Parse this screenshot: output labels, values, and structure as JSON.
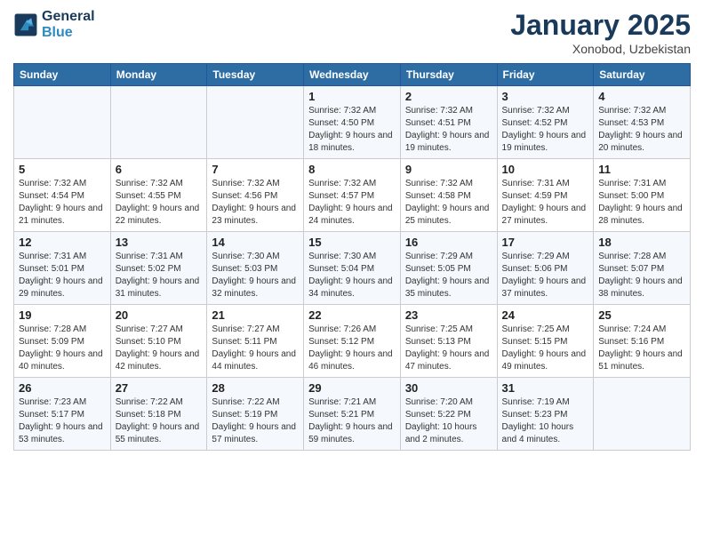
{
  "header": {
    "logo_line1": "General",
    "logo_line2": "Blue",
    "month": "January 2025",
    "location": "Xonobod, Uzbekistan"
  },
  "weekdays": [
    "Sunday",
    "Monday",
    "Tuesday",
    "Wednesday",
    "Thursday",
    "Friday",
    "Saturday"
  ],
  "weeks": [
    [
      {
        "num": "",
        "sunrise": "",
        "sunset": "",
        "daylight": ""
      },
      {
        "num": "",
        "sunrise": "",
        "sunset": "",
        "daylight": ""
      },
      {
        "num": "",
        "sunrise": "",
        "sunset": "",
        "daylight": ""
      },
      {
        "num": "1",
        "sunrise": "Sunrise: 7:32 AM",
        "sunset": "Sunset: 4:50 PM",
        "daylight": "Daylight: 9 hours and 18 minutes."
      },
      {
        "num": "2",
        "sunrise": "Sunrise: 7:32 AM",
        "sunset": "Sunset: 4:51 PM",
        "daylight": "Daylight: 9 hours and 19 minutes."
      },
      {
        "num": "3",
        "sunrise": "Sunrise: 7:32 AM",
        "sunset": "Sunset: 4:52 PM",
        "daylight": "Daylight: 9 hours and 19 minutes."
      },
      {
        "num": "4",
        "sunrise": "Sunrise: 7:32 AM",
        "sunset": "Sunset: 4:53 PM",
        "daylight": "Daylight: 9 hours and 20 minutes."
      }
    ],
    [
      {
        "num": "5",
        "sunrise": "Sunrise: 7:32 AM",
        "sunset": "Sunset: 4:54 PM",
        "daylight": "Daylight: 9 hours and 21 minutes."
      },
      {
        "num": "6",
        "sunrise": "Sunrise: 7:32 AM",
        "sunset": "Sunset: 4:55 PM",
        "daylight": "Daylight: 9 hours and 22 minutes."
      },
      {
        "num": "7",
        "sunrise": "Sunrise: 7:32 AM",
        "sunset": "Sunset: 4:56 PM",
        "daylight": "Daylight: 9 hours and 23 minutes."
      },
      {
        "num": "8",
        "sunrise": "Sunrise: 7:32 AM",
        "sunset": "Sunset: 4:57 PM",
        "daylight": "Daylight: 9 hours and 24 minutes."
      },
      {
        "num": "9",
        "sunrise": "Sunrise: 7:32 AM",
        "sunset": "Sunset: 4:58 PM",
        "daylight": "Daylight: 9 hours and 25 minutes."
      },
      {
        "num": "10",
        "sunrise": "Sunrise: 7:31 AM",
        "sunset": "Sunset: 4:59 PM",
        "daylight": "Daylight: 9 hours and 27 minutes."
      },
      {
        "num": "11",
        "sunrise": "Sunrise: 7:31 AM",
        "sunset": "Sunset: 5:00 PM",
        "daylight": "Daylight: 9 hours and 28 minutes."
      }
    ],
    [
      {
        "num": "12",
        "sunrise": "Sunrise: 7:31 AM",
        "sunset": "Sunset: 5:01 PM",
        "daylight": "Daylight: 9 hours and 29 minutes."
      },
      {
        "num": "13",
        "sunrise": "Sunrise: 7:31 AM",
        "sunset": "Sunset: 5:02 PM",
        "daylight": "Daylight: 9 hours and 31 minutes."
      },
      {
        "num": "14",
        "sunrise": "Sunrise: 7:30 AM",
        "sunset": "Sunset: 5:03 PM",
        "daylight": "Daylight: 9 hours and 32 minutes."
      },
      {
        "num": "15",
        "sunrise": "Sunrise: 7:30 AM",
        "sunset": "Sunset: 5:04 PM",
        "daylight": "Daylight: 9 hours and 34 minutes."
      },
      {
        "num": "16",
        "sunrise": "Sunrise: 7:29 AM",
        "sunset": "Sunset: 5:05 PM",
        "daylight": "Daylight: 9 hours and 35 minutes."
      },
      {
        "num": "17",
        "sunrise": "Sunrise: 7:29 AM",
        "sunset": "Sunset: 5:06 PM",
        "daylight": "Daylight: 9 hours and 37 minutes."
      },
      {
        "num": "18",
        "sunrise": "Sunrise: 7:28 AM",
        "sunset": "Sunset: 5:07 PM",
        "daylight": "Daylight: 9 hours and 38 minutes."
      }
    ],
    [
      {
        "num": "19",
        "sunrise": "Sunrise: 7:28 AM",
        "sunset": "Sunset: 5:09 PM",
        "daylight": "Daylight: 9 hours and 40 minutes."
      },
      {
        "num": "20",
        "sunrise": "Sunrise: 7:27 AM",
        "sunset": "Sunset: 5:10 PM",
        "daylight": "Daylight: 9 hours and 42 minutes."
      },
      {
        "num": "21",
        "sunrise": "Sunrise: 7:27 AM",
        "sunset": "Sunset: 5:11 PM",
        "daylight": "Daylight: 9 hours and 44 minutes."
      },
      {
        "num": "22",
        "sunrise": "Sunrise: 7:26 AM",
        "sunset": "Sunset: 5:12 PM",
        "daylight": "Daylight: 9 hours and 46 minutes."
      },
      {
        "num": "23",
        "sunrise": "Sunrise: 7:25 AM",
        "sunset": "Sunset: 5:13 PM",
        "daylight": "Daylight: 9 hours and 47 minutes."
      },
      {
        "num": "24",
        "sunrise": "Sunrise: 7:25 AM",
        "sunset": "Sunset: 5:15 PM",
        "daylight": "Daylight: 9 hours and 49 minutes."
      },
      {
        "num": "25",
        "sunrise": "Sunrise: 7:24 AM",
        "sunset": "Sunset: 5:16 PM",
        "daylight": "Daylight: 9 hours and 51 minutes."
      }
    ],
    [
      {
        "num": "26",
        "sunrise": "Sunrise: 7:23 AM",
        "sunset": "Sunset: 5:17 PM",
        "daylight": "Daylight: 9 hours and 53 minutes."
      },
      {
        "num": "27",
        "sunrise": "Sunrise: 7:22 AM",
        "sunset": "Sunset: 5:18 PM",
        "daylight": "Daylight: 9 hours and 55 minutes."
      },
      {
        "num": "28",
        "sunrise": "Sunrise: 7:22 AM",
        "sunset": "Sunset: 5:19 PM",
        "daylight": "Daylight: 9 hours and 57 minutes."
      },
      {
        "num": "29",
        "sunrise": "Sunrise: 7:21 AM",
        "sunset": "Sunset: 5:21 PM",
        "daylight": "Daylight: 9 hours and 59 minutes."
      },
      {
        "num": "30",
        "sunrise": "Sunrise: 7:20 AM",
        "sunset": "Sunset: 5:22 PM",
        "daylight": "Daylight: 10 hours and 2 minutes."
      },
      {
        "num": "31",
        "sunrise": "Sunrise: 7:19 AM",
        "sunset": "Sunset: 5:23 PM",
        "daylight": "Daylight: 10 hours and 4 minutes."
      },
      {
        "num": "",
        "sunrise": "",
        "sunset": "",
        "daylight": ""
      }
    ]
  ]
}
